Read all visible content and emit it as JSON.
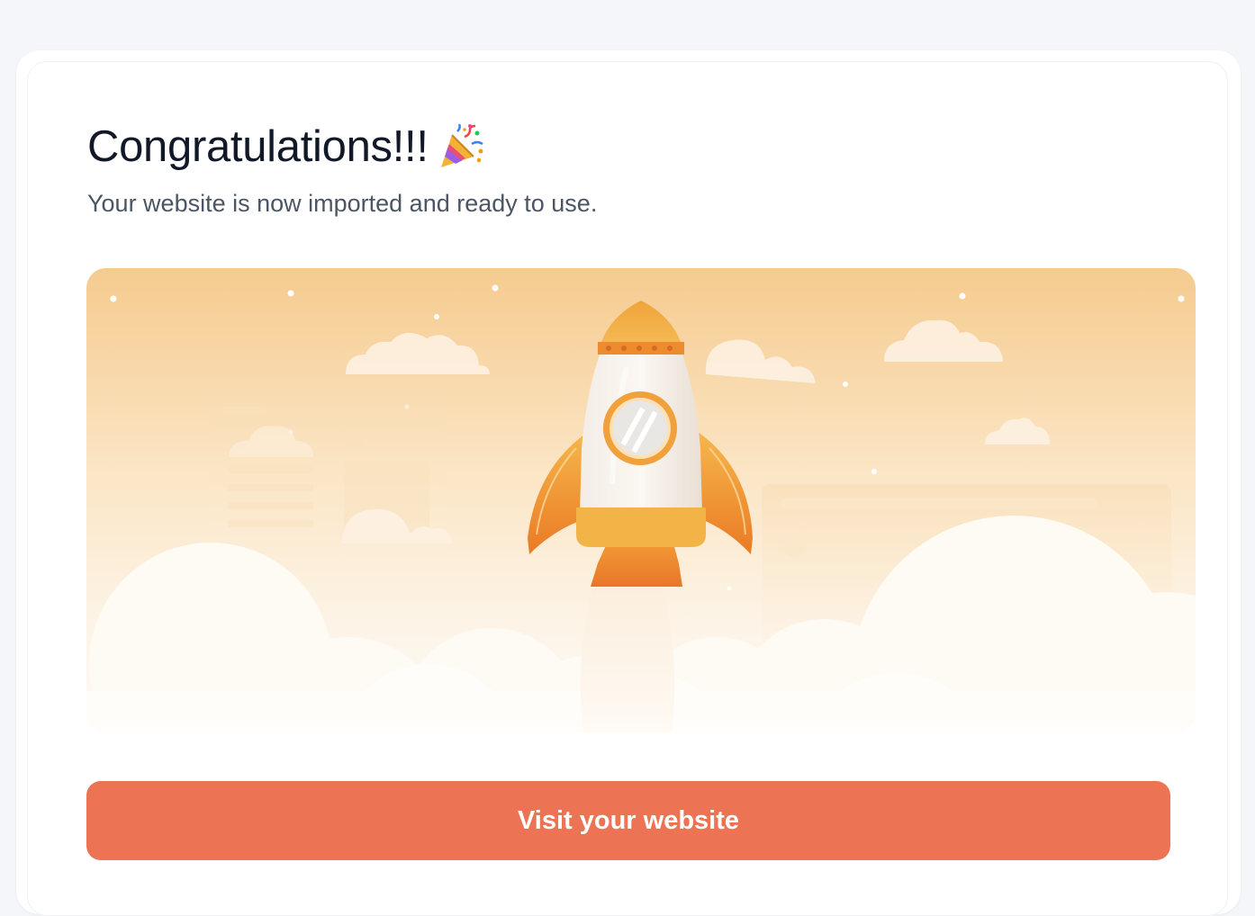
{
  "card": {
    "heading": "Congratulations!!!",
    "heading_icon": "party-popper-icon",
    "subtitle": "Your website is now imported and ready to use.",
    "illustration": "rocket-launch-illustration",
    "cta_label": "Visit your website"
  },
  "colors": {
    "page_background": "#f5f6fa",
    "card_background": "#ffffff",
    "heading_text": "#111827",
    "subtitle_text": "#4b5563",
    "button_background": "#ec7455",
    "button_text": "#ffffff",
    "illustration_sky_top": "#f5cb8f",
    "rocket_orange": "#f0a53c"
  }
}
